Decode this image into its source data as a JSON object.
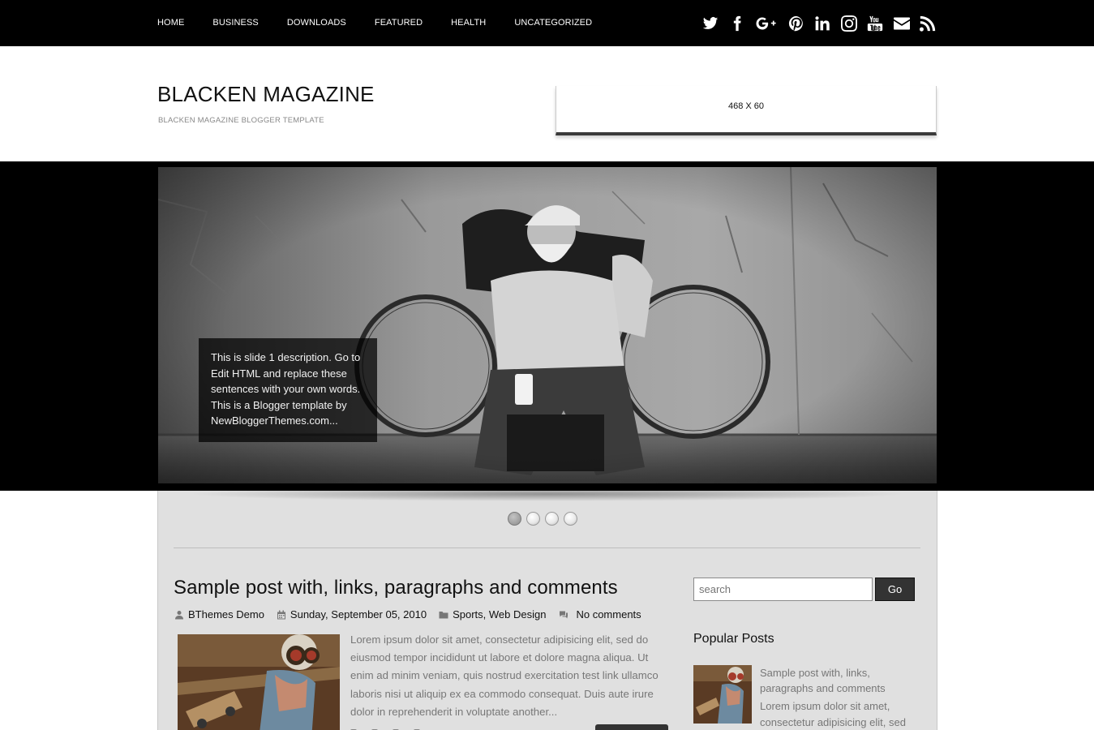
{
  "nav": {
    "items": [
      "HOME",
      "BUSINESS",
      "DOWNLOADS",
      "FEATURED",
      "HEALTH",
      "UNCATEGORIZED"
    ]
  },
  "social": [
    "twitter-icon",
    "facebook-icon",
    "google-plus-icon",
    "pinterest-icon",
    "linkedin-icon",
    "instagram-icon",
    "youtube-icon",
    "email-icon",
    "rss-icon"
  ],
  "header": {
    "title": "BLACKEN MAGAZINE",
    "description": "BLACKEN MAGAZINE BLOGGER TEMPLATE",
    "ad_label": "468 X 60"
  },
  "slider": {
    "caption": "This is slide 1 description. Go to Edit HTML and replace these sentences with your own words. This is a Blogger template by NewBloggerThemes.com...",
    "active_slide": 1,
    "slide_count": 4
  },
  "post": {
    "title": "Sample post with, links, paragraphs and comments",
    "author": "BThemes Demo",
    "date": "Sunday, September 05, 2010",
    "label_1": "Sports",
    "label_2": "Web Design",
    "comments": "No comments",
    "excerpt": "Lorem ipsum dolor sit amet, consectetur adipisicing elit, sed do eiusmod tempor incididunt ut labore et dolore magna aliqua. Ut enim ad minim veniam, quis nostrud exercitation test link ullamco laboris nisi ut aliquip ex ea commodo consequat. Duis aute irure dolor in reprehenderit in voluptate another..."
  },
  "sidebar": {
    "search_placeholder": "search",
    "search_button": "Go",
    "popular_title": "Popular Posts",
    "popular_post_title": "Sample post with, links, paragraphs and comments",
    "popular_post_excerpt": "Lorem ipsum dolor sit amet, consectetur adipisicing elit, sed"
  },
  "colors": {
    "topbar": "#000000",
    "content_bg": "#e0e0e0",
    "button": "#333333"
  }
}
